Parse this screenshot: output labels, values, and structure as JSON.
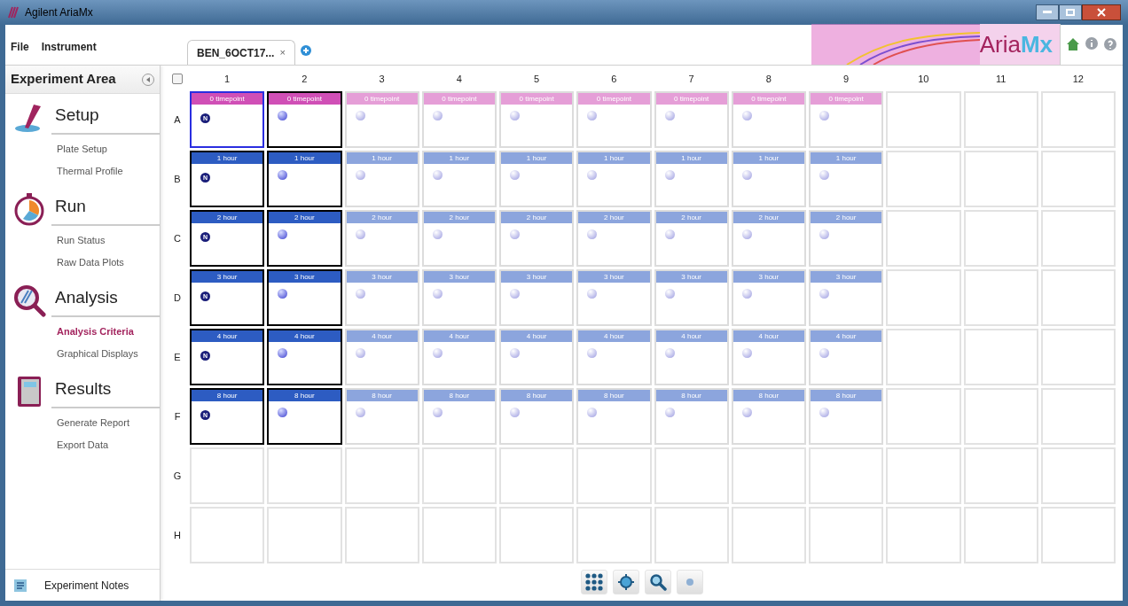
{
  "window": {
    "title": "Agilent AriaMx"
  },
  "menu": [
    "File",
    "Instrument"
  ],
  "tabs": [
    {
      "label": "BEN_6OCT17...",
      "selected": true,
      "close": "×"
    }
  ],
  "brand": {
    "name": "Aria",
    "suffix": "Mx"
  },
  "sidebar": {
    "title": "Experiment Area",
    "sections": [
      {
        "kind": "setup",
        "title": "Setup",
        "items": [
          {
            "label": "Plate Setup",
            "selected": false
          },
          {
            "label": "Thermal Profile",
            "selected": false
          }
        ]
      },
      {
        "kind": "run",
        "title": "Run",
        "items": [
          {
            "label": "Run Status",
            "selected": false
          },
          {
            "label": "Raw Data Plots",
            "selected": false
          }
        ]
      },
      {
        "kind": "analysis",
        "title": "Analysis",
        "items": [
          {
            "label": "Analysis Criteria",
            "selected": true
          },
          {
            "label": "Graphical Displays",
            "selected": false
          }
        ]
      },
      {
        "kind": "results",
        "title": "Results",
        "items": [
          {
            "label": "Generate Report",
            "selected": false
          },
          {
            "label": "Export Data",
            "selected": false
          }
        ]
      }
    ],
    "footer": "Experiment Notes"
  },
  "plate": {
    "select_all_checked": false,
    "columns": [
      "1",
      "2",
      "3",
      "4",
      "5",
      "6",
      "7",
      "8",
      "9",
      "10",
      "11",
      "12"
    ],
    "rows": [
      {
        "label": "A",
        "color": "#d04fb6",
        "wells": [
          {
            "kind": "sample",
            "label": "0 timepoint",
            "selected": true,
            "focused": true,
            "marker": "N"
          },
          {
            "kind": "sample",
            "label": "0 timepoint",
            "selected": true,
            "focused": false
          },
          {
            "kind": "sample",
            "label": "0 timepoint",
            "selected": false,
            "focused": false
          },
          {
            "kind": "sample",
            "label": "0 timepoint",
            "selected": false,
            "focused": false
          },
          {
            "kind": "sample",
            "label": "0 timepoint",
            "selected": false,
            "focused": false
          },
          {
            "kind": "sample",
            "label": "0 timepoint",
            "selected": false,
            "focused": false
          },
          {
            "kind": "sample",
            "label": "0 timepoint",
            "selected": false,
            "focused": false
          },
          {
            "kind": "sample",
            "label": "0 timepoint",
            "selected": false,
            "focused": false
          },
          {
            "kind": "sample",
            "label": "0 timepoint",
            "selected": false,
            "focused": false
          },
          {
            "kind": "empty"
          },
          {
            "kind": "empty"
          },
          {
            "kind": "empty"
          }
        ]
      },
      {
        "label": "B",
        "color": "#2d5cc2",
        "wells": [
          {
            "kind": "sample",
            "label": "1 hour",
            "selected": true,
            "focused": false,
            "marker": "N"
          },
          {
            "kind": "sample",
            "label": "1 hour",
            "selected": true,
            "focused": false
          },
          {
            "kind": "sample",
            "label": "1 hour",
            "selected": false,
            "focused": false
          },
          {
            "kind": "sample",
            "label": "1 hour",
            "selected": false,
            "focused": false
          },
          {
            "kind": "sample",
            "label": "1 hour",
            "selected": false,
            "focused": false
          },
          {
            "kind": "sample",
            "label": "1 hour",
            "selected": false,
            "focused": false
          },
          {
            "kind": "sample",
            "label": "1 hour",
            "selected": false,
            "focused": false
          },
          {
            "kind": "sample",
            "label": "1 hour",
            "selected": false,
            "focused": false
          },
          {
            "kind": "sample",
            "label": "1 hour",
            "selected": false,
            "focused": false
          },
          {
            "kind": "empty"
          },
          {
            "kind": "empty"
          },
          {
            "kind": "empty"
          }
        ]
      },
      {
        "label": "C",
        "color": "#2d5cc2",
        "wells": [
          {
            "kind": "sample",
            "label": "2 hour",
            "selected": true,
            "focused": false,
            "marker": "N"
          },
          {
            "kind": "sample",
            "label": "2 hour",
            "selected": true,
            "focused": false
          },
          {
            "kind": "sample",
            "label": "2 hour",
            "selected": false,
            "focused": false
          },
          {
            "kind": "sample",
            "label": "2 hour",
            "selected": false,
            "focused": false
          },
          {
            "kind": "sample",
            "label": "2 hour",
            "selected": false,
            "focused": false
          },
          {
            "kind": "sample",
            "label": "2 hour",
            "selected": false,
            "focused": false
          },
          {
            "kind": "sample",
            "label": "2 hour",
            "selected": false,
            "focused": false
          },
          {
            "kind": "sample",
            "label": "2 hour",
            "selected": false,
            "focused": false
          },
          {
            "kind": "sample",
            "label": "2 hour",
            "selected": false,
            "focused": false
          },
          {
            "kind": "empty"
          },
          {
            "kind": "empty"
          },
          {
            "kind": "empty"
          }
        ]
      },
      {
        "label": "D",
        "color": "#2d5cc2",
        "wells": [
          {
            "kind": "sample",
            "label": "3 hour",
            "selected": true,
            "focused": false,
            "marker": "N"
          },
          {
            "kind": "sample",
            "label": "3 hour",
            "selected": true,
            "focused": false
          },
          {
            "kind": "sample",
            "label": "3 hour",
            "selected": false,
            "focused": false
          },
          {
            "kind": "sample",
            "label": "3 hour",
            "selected": false,
            "focused": false
          },
          {
            "kind": "sample",
            "label": "3 hour",
            "selected": false,
            "focused": false
          },
          {
            "kind": "sample",
            "label": "3 hour",
            "selected": false,
            "focused": false
          },
          {
            "kind": "sample",
            "label": "3 hour",
            "selected": false,
            "focused": false
          },
          {
            "kind": "sample",
            "label": "3 hour",
            "selected": false,
            "focused": false
          },
          {
            "kind": "sample",
            "label": "3 hour",
            "selected": false,
            "focused": false
          },
          {
            "kind": "empty"
          },
          {
            "kind": "empty"
          },
          {
            "kind": "empty"
          }
        ]
      },
      {
        "label": "E",
        "color": "#2d5cc2",
        "wells": [
          {
            "kind": "sample",
            "label": "4 hour",
            "selected": true,
            "focused": false,
            "marker": "N"
          },
          {
            "kind": "sample",
            "label": "4 hour",
            "selected": true,
            "focused": false
          },
          {
            "kind": "sample",
            "label": "4 hour",
            "selected": false,
            "focused": false
          },
          {
            "kind": "sample",
            "label": "4 hour",
            "selected": false,
            "focused": false
          },
          {
            "kind": "sample",
            "label": "4 hour",
            "selected": false,
            "focused": false
          },
          {
            "kind": "sample",
            "label": "4 hour",
            "selected": false,
            "focused": false
          },
          {
            "kind": "sample",
            "label": "4 hour",
            "selected": false,
            "focused": false
          },
          {
            "kind": "sample",
            "label": "4 hour",
            "selected": false,
            "focused": false
          },
          {
            "kind": "sample",
            "label": "4 hour",
            "selected": false,
            "focused": false
          },
          {
            "kind": "empty"
          },
          {
            "kind": "empty"
          },
          {
            "kind": "empty"
          }
        ]
      },
      {
        "label": "F",
        "color": "#2d5cc2",
        "wells": [
          {
            "kind": "sample",
            "label": "8 hour",
            "selected": true,
            "focused": false,
            "marker": "N"
          },
          {
            "kind": "sample",
            "label": "8 hour",
            "selected": true,
            "focused": false
          },
          {
            "kind": "sample",
            "label": "8 hour",
            "selected": false,
            "focused": false
          },
          {
            "kind": "sample",
            "label": "8 hour",
            "selected": false,
            "focused": false
          },
          {
            "kind": "sample",
            "label": "8 hour",
            "selected": false,
            "focused": false
          },
          {
            "kind": "sample",
            "label": "8 hour",
            "selected": false,
            "focused": false
          },
          {
            "kind": "sample",
            "label": "8 hour",
            "selected": false,
            "focused": false
          },
          {
            "kind": "sample",
            "label": "8 hour",
            "selected": false,
            "focused": false
          },
          {
            "kind": "sample",
            "label": "8 hour",
            "selected": false,
            "focused": false
          },
          {
            "kind": "empty"
          },
          {
            "kind": "empty"
          },
          {
            "kind": "empty"
          }
        ]
      },
      {
        "label": "G",
        "wells": [
          {
            "kind": "empty"
          },
          {
            "kind": "empty"
          },
          {
            "kind": "empty"
          },
          {
            "kind": "empty"
          },
          {
            "kind": "empty"
          },
          {
            "kind": "empty"
          },
          {
            "kind": "empty"
          },
          {
            "kind": "empty"
          },
          {
            "kind": "empty"
          },
          {
            "kind": "empty"
          },
          {
            "kind": "empty"
          },
          {
            "kind": "empty"
          }
        ]
      },
      {
        "label": "H",
        "wells": [
          {
            "kind": "empty"
          },
          {
            "kind": "empty"
          },
          {
            "kind": "empty"
          },
          {
            "kind": "empty"
          },
          {
            "kind": "empty"
          },
          {
            "kind": "empty"
          },
          {
            "kind": "empty"
          },
          {
            "kind": "empty"
          },
          {
            "kind": "empty"
          },
          {
            "kind": "empty"
          },
          {
            "kind": "empty"
          },
          {
            "kind": "empty"
          }
        ]
      }
    ]
  },
  "toolbar": [
    {
      "kind": "grid",
      "selected": false
    },
    {
      "kind": "target",
      "selected": false
    },
    {
      "kind": "zoom",
      "selected": false
    },
    {
      "kind": "dot",
      "selected": false
    }
  ]
}
